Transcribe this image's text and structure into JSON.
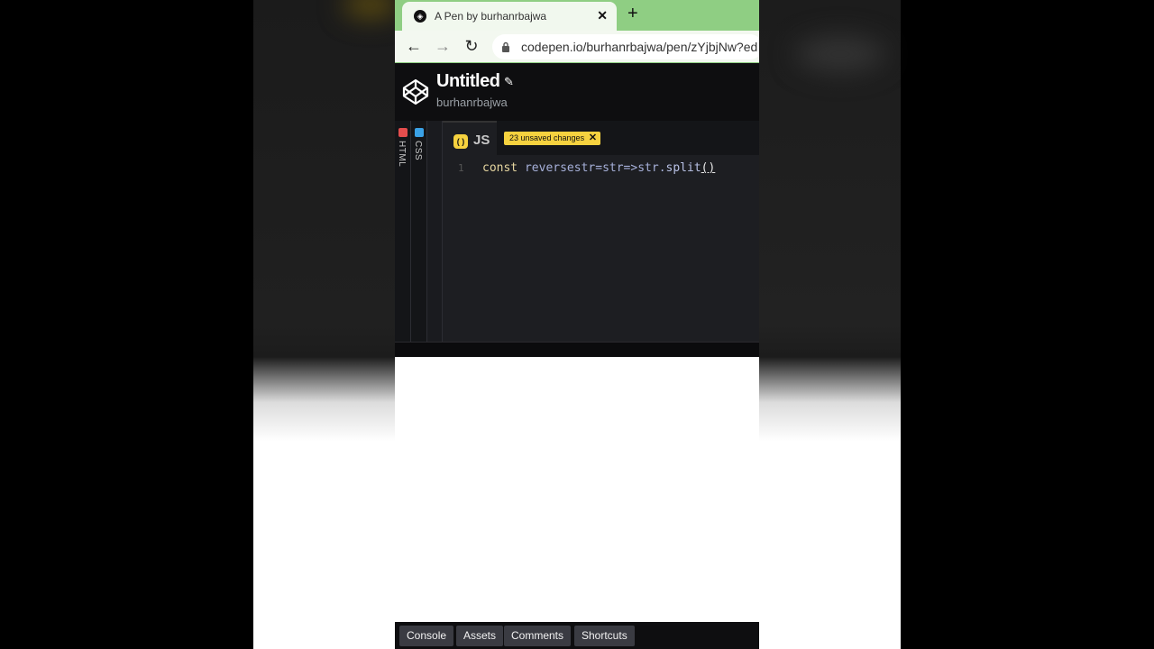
{
  "browser": {
    "tab_title": "A Pen by burhanrbajwa",
    "url": "codepen.io/burhanrbajwa/pen/zYjbjNw?ed"
  },
  "codepen": {
    "title": "Untitled",
    "user": "burhanrbajwa"
  },
  "editor": {
    "rails": [
      "HTML",
      "CSS"
    ],
    "active_tab": "JS",
    "unsaved_badge": "23 unsaved changes",
    "line_number": "1",
    "code_tokens": {
      "keyword": "const",
      "var_name": "reversestr",
      "rest": "=str=>str.",
      "method": "split",
      "parens": "()"
    }
  },
  "footer": {
    "buttons": [
      "Console",
      "Assets",
      "Comments",
      "Shortcuts"
    ]
  },
  "colors": {
    "tabbar": "#8fce83",
    "js_badge": "#f6d23f",
    "html_dot": "#e44d4d",
    "css_dot": "#3aa1e6"
  }
}
